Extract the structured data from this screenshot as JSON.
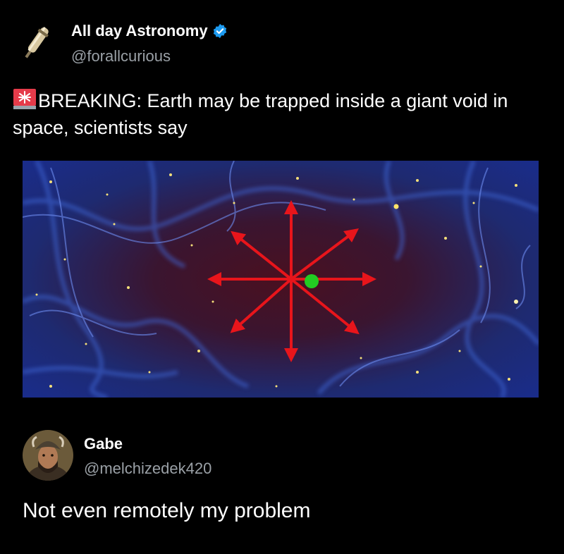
{
  "post": {
    "author_name": "All day Astronomy",
    "author_handle": "@forallcurious",
    "verified": true,
    "text": "BREAKING: Earth may be trapped inside a giant void in space, scientists say",
    "leading_emoji": "rotating-light"
  },
  "reply": {
    "author_name": "Gabe",
    "author_handle": "@melchizedek420",
    "text": "Not even remotely my problem"
  },
  "colors": {
    "background": "#000000",
    "verified_badge": "#1d9bf0",
    "arrow_red": "#e8151b",
    "earth_marker": "#22cc22"
  }
}
